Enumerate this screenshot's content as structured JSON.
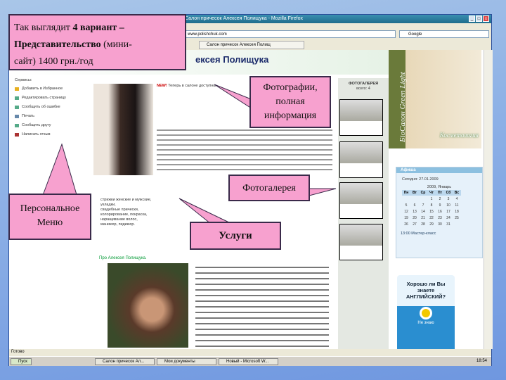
{
  "slide": {
    "caption_line1": "Так выглядит ",
    "caption_bold": "4 вариант –",
    "caption_line2_bold": "Представительство",
    "caption_line2": " (мини-",
    "caption_line3": "сайт) 1400 грн./год"
  },
  "callouts": {
    "photos": "Фотографии, полная информация",
    "gallery": "Фотогалерея",
    "menu": "Персональное Меню",
    "services": "Услуги"
  },
  "browser": {
    "title": "Салон причесок Алексея Полищука - Mozilla Firefox",
    "address": "www.polishchuk.com",
    "search_placeholder": "Google",
    "tab_label": "Салон причесок Алексея Полищ",
    "status": "Готово"
  },
  "site": {
    "heading": "ексея Полищука",
    "menu_title": "Сервисы:",
    "menu": [
      "Добавить в Избранное",
      "Редактировать страницу",
      "Сообщить об ошибке",
      "Печать",
      "Сообщить другу",
      "Написать отзыв"
    ],
    "intro_new": "NEW!",
    "intro": "Теперь в салоне доступны ...",
    "about_link": "Про Алексея Полищука.",
    "services": [
      "стрижки женские и мужские,",
      "укладки,",
      "свадебные прически,",
      "колорирование, покраска,",
      "наращивание волос,",
      "маникюр, педикюр."
    ],
    "gallery_title": "ФОТОГАЛЕРЕЯ",
    "gallery_sub": "всего: 4",
    "banner_brand": "БіоСалон Green Light",
    "banner_caption": "Косметология",
    "afisha_title": "Афиша",
    "today": "Сегодня: 27.01.2009",
    "cal_month": "2009, Январь",
    "weekdays": [
      "Пн",
      "Вт",
      "Ср",
      "Чт",
      "Пт",
      "Сб",
      "Вс"
    ],
    "weeks": [
      [
        "",
        "",
        "",
        "1",
        "2",
        "3",
        "4"
      ],
      [
        "5",
        "6",
        "7",
        "8",
        "9",
        "10",
        "11"
      ],
      [
        "12",
        "13",
        "14",
        "15",
        "16",
        "17",
        "18"
      ],
      [
        "19",
        "20",
        "21",
        "22",
        "23",
        "24",
        "25"
      ],
      [
        "26",
        "27",
        "28",
        "29",
        "30",
        "31",
        ""
      ]
    ],
    "afisha_note": "13:00 Мастер-класс",
    "english_ad": "Хорошо ли Вы знаете АНГЛИЙСКИЙ?",
    "english_btn": "Не знаю"
  },
  "taskbar": {
    "start": "Пуск",
    "items": [
      "Салон причесок Ал...",
      "Мои документы",
      "Новый - Microsoft W..."
    ],
    "clock": "18:54"
  }
}
